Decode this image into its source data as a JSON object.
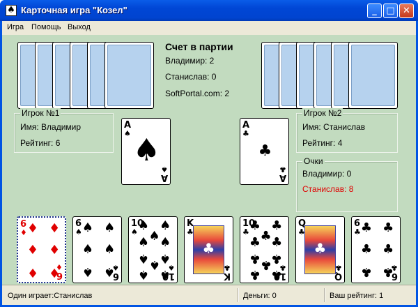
{
  "window": {
    "title": "Карточная игра \"Козел\"",
    "icon": "spade-icon"
  },
  "menu": {
    "items": [
      "Игра",
      "Помощь",
      "Выход"
    ]
  },
  "score": {
    "title": "Счет в партии",
    "rows": [
      "Владимир: 2",
      "Станислав: 0",
      "SoftPortal.com: 2"
    ]
  },
  "player1": {
    "title": "Игрок №1",
    "name": "Имя: Владимир",
    "rating": "Рейтинг: 6"
  },
  "player2": {
    "title": "Игрок №2",
    "name": "Имя: Станислав",
    "rating": "Рейтинг: 4"
  },
  "points": {
    "title": "Очки",
    "p1": "Владимир: 0",
    "p2": "Станислав: 8",
    "highlight_color": "#e00000"
  },
  "played": [
    {
      "rank": "A",
      "suit": "spades"
    },
    {
      "rank": "A",
      "suit": "clubs"
    }
  ],
  "hand": [
    {
      "rank": "6",
      "suit": "diamonds",
      "selected": true
    },
    {
      "rank": "6",
      "suit": "spades",
      "selected": false
    },
    {
      "rank": "10",
      "suit": "spades",
      "selected": false
    },
    {
      "rank": "K",
      "suit": "clubs",
      "selected": false
    },
    {
      "rank": "10",
      "suit": "clubs",
      "selected": false
    },
    {
      "rank": "Q",
      "suit": "clubs",
      "selected": false
    },
    {
      "rank": "6",
      "suit": "clubs",
      "selected": false
    }
  ],
  "status": {
    "mode": "Один играет:Станислав",
    "money": "Деньги: 0",
    "rating": "Ваш рейтинг: 1"
  },
  "colors": {
    "table": "#c2dbbf",
    "card_back": "#b6d2ee",
    "title_bar": "#0054e3",
    "suit_red": "#e00000"
  }
}
